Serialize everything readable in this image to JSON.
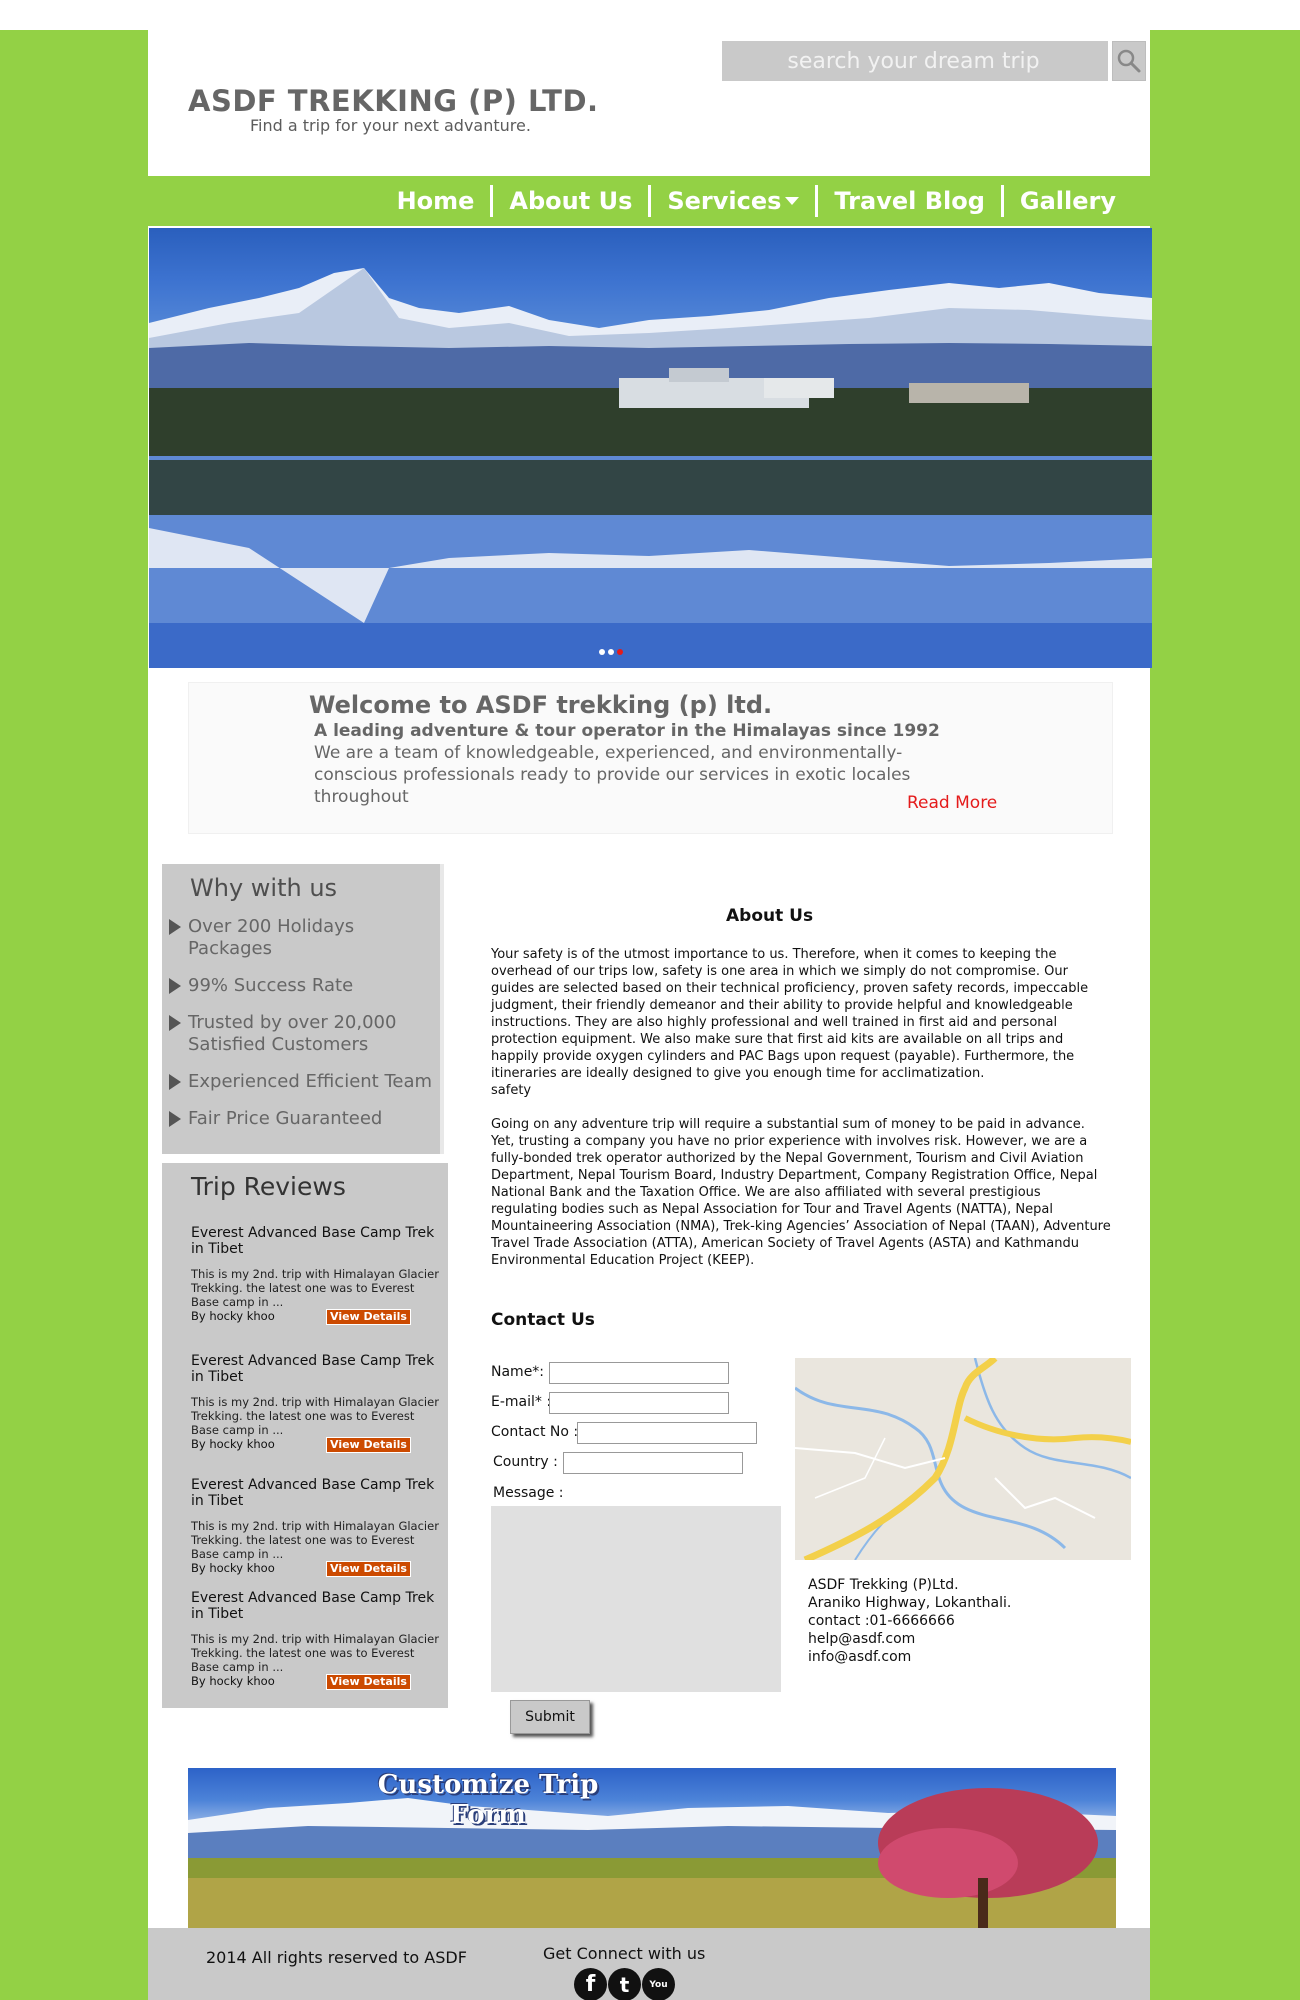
{
  "header": {
    "search_placeholder": "search your dream trip",
    "title": "ASDF TREKKING (P) LTD.",
    "tagline": "Find a trip for your next advanture."
  },
  "nav": {
    "items": [
      "Home",
      "About Us",
      "Services",
      "Travel Blog",
      "Gallery"
    ]
  },
  "hero": {
    "slides": 3,
    "active_slide": 3
  },
  "welcome": {
    "title": "Welcome to ASDF trekking (p) ltd.",
    "subtitle": "A leading adventure & tour operator in the Himalayas since 1992",
    "body": "We are a team of knowledgeable, experienced, and environmentally-conscious professionals ready to provide our services in exotic locales throughout",
    "read_more": "Read More"
  },
  "why": {
    "title": "Why with us",
    "items": [
      "Over 200 Holidays Packages",
      "99% Success Rate",
      "Trusted by over 20,000 Satisfied Customers",
      "Experienced Efficient Team",
      "Fair Price Guaranteed"
    ]
  },
  "reviews": {
    "title": "Trip Reviews",
    "items": [
      {
        "title": "Everest Advanced Base Camp Trek in Tibet",
        "text": "This is my 2nd. trip with Himalayan Glacier Trekking. the latest one was to Everest Base camp in ...",
        "author": "By hocky khoo",
        "link": "View Details"
      },
      {
        "title": "Everest Advanced Base Camp Trek in Tibet",
        "text": "This is my 2nd. trip with Himalayan Glacier Trekking. the latest one was to Everest Base camp in ...",
        "author": "By hocky khoo",
        "link": "View Details"
      },
      {
        "title": "Everest Advanced Base Camp Trek in Tibet",
        "text": "This is my 2nd. trip with Himalayan Glacier Trekking. the latest one was to Everest Base camp in ...",
        "author": "By hocky khoo",
        "link": "View Details"
      },
      {
        "title": "Everest Advanced Base Camp Trek in Tibet",
        "text": "This is my 2nd. trip with Himalayan Glacier Trekking. the latest one was to Everest Base camp in ...",
        "author": "By hocky khoo",
        "link": "View Details"
      }
    ]
  },
  "about": {
    "title": "About Us",
    "p1": "Your safety is of the utmost importance to us. Therefore, when it comes to keeping the overhead of our trips low, safety is one area in which we simply do not compromise. Our guides are selected based on their technical proficiency, proven safety records, impeccable judgment, their friendly demeanor and their ability to provide helpful and knowledgeable instructions. They are also highly professional and well trained in first aid and personal protection equipment. We also make sure that first aid kits are available on all trips and happily provide oxygen cylinders and PAC Bags upon request (payable). Furthermore, the itineraries are ideally designed to give you enough time for acclimatization.",
    "p1_tail": "safety",
    "p2": "Going on any adventure trip will require a substantial sum of money to be paid in advance. Yet, trusting a company you have no prior experience with involves risk. However, we are a fully-bonded trek operator authorized by the Nepal Government, Tourism and Civil Aviation Department, Nepal Tourism Board, Industry Department, Company Registration Office, Nepal National Bank and the Taxation Office. We are also affiliated with several prestigious regulating bodies such as Nepal Association for Tour and Travel Agents (NATTA), Nepal Mountaineering Association (NMA), Trek-king Agencies’ Association of Nepal (TAAN), Adventure Travel Trade Association (ATTA), American Society of Travel Agents (ASTA) and Kathmandu Environmental Education Project (KEEP)."
  },
  "contact": {
    "title": "Contact Us",
    "name_label": "Name*:",
    "email_label": "E-mail* :",
    "phone_label": "Contact No :",
    "country_label": "Country :",
    "message_label": "Message :",
    "submit": "Submit",
    "address": [
      "ASDF Trekking (P)Ltd.",
      "Araniko Highway, Lokanthali.",
      "contact :01-6666666",
      "help@asdf.com",
      "info@asdf.com"
    ]
  },
  "banner": {
    "title_line1": "Customize Trip",
    "title_line2": "Form"
  },
  "footer": {
    "copyright": "2014 All rights reserved to ASDF",
    "connect": "Get Connect with us",
    "social": [
      "facebook-icon",
      "twitter-icon",
      "youtube-icon"
    ]
  },
  "colors": {
    "brand_green": "#93d145",
    "panel_gray": "#c9c9c9",
    "accent_red": "#e41b1b",
    "button_orange": "#cc4a00"
  }
}
